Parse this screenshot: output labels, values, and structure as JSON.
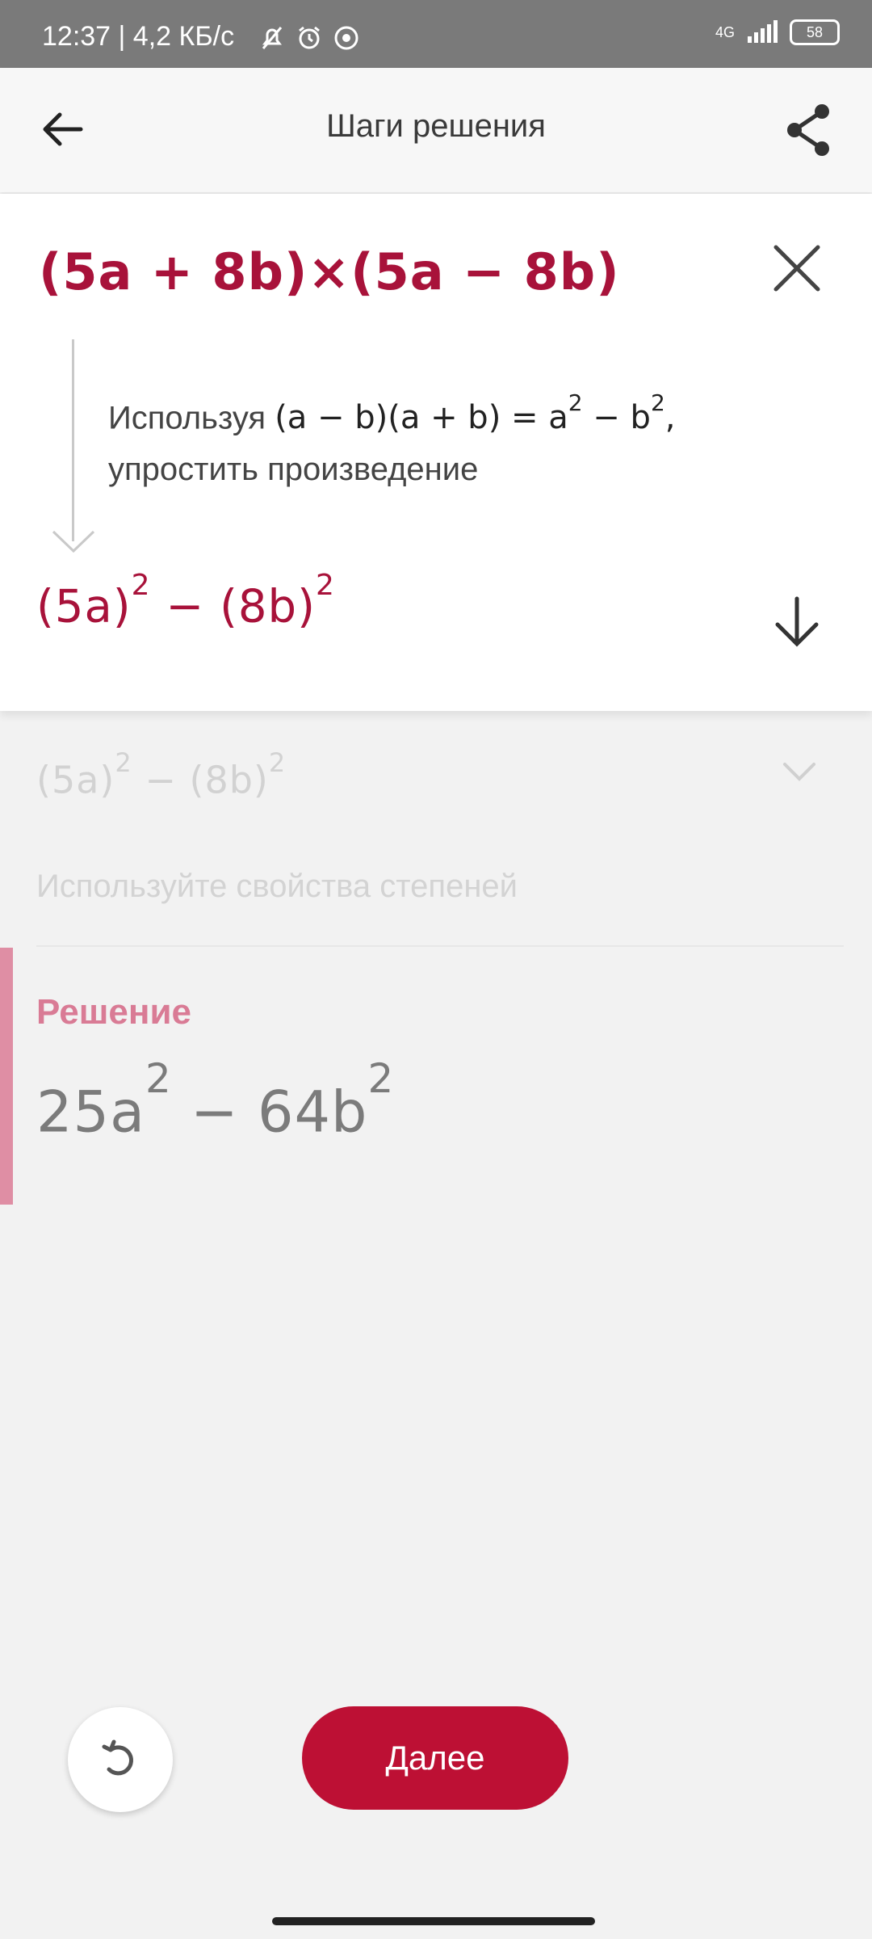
{
  "status": {
    "time": "12:37 | 4,2 КБ/с",
    "network": "4G",
    "battery": "58"
  },
  "toolbar": {
    "title": "Шаги решения"
  },
  "step": {
    "expression": "(5a + 8b)×(5a − 8b)",
    "explain_prefix": "Используя",
    "formula_main": "(a − b)(a + b) = a",
    "formula_sup1": "2",
    "formula_mid": " − b",
    "formula_sup2": "2",
    "formula_suffix": ",",
    "explain_line2": "упростить произведение",
    "result_a": "(5a)",
    "result_sup1": "2",
    "result_minus": " − ",
    "result_b": "(8b)",
    "result_sup2": "2"
  },
  "next_step": {
    "expr_a": "(5a)",
    "expr_sup1": "2",
    "expr_minus": " − ",
    "expr_b": "(8b)",
    "expr_sup2": "2",
    "description": "Используйте свойства степеней"
  },
  "solution": {
    "label": "Решение",
    "part1": "25a",
    "sup1": "2",
    "minus": " − ",
    "part2": "64b",
    "sup2": "2"
  },
  "buttons": {
    "next_label": "Далее"
  },
  "colors": {
    "accent": "#bd1034",
    "formula": "#a8123a",
    "solution_bar": "#df8ea4"
  }
}
